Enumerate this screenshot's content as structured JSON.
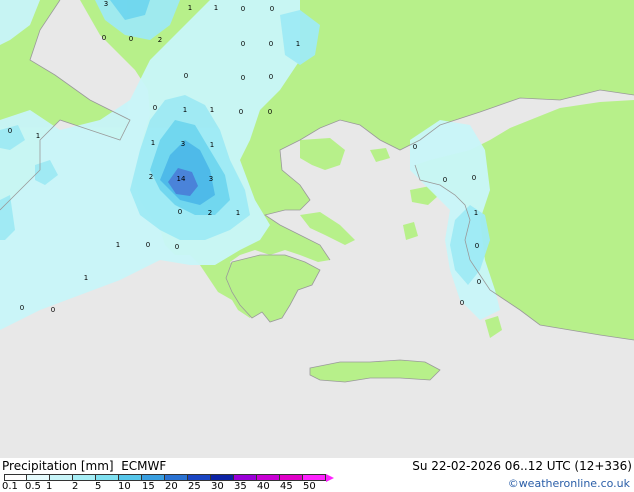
{
  "map": {
    "colors": {
      "sea": "#e8e8e8",
      "land": "#b7f08a",
      "coast": "#9a9a9a",
      "precip_light": "#c8f5f9",
      "precip_mid": "#9eeaf4",
      "precip_heavy": "#6fd6ee",
      "precip_strong": "#4cb8e8",
      "precip_peak": "#4a7fd8"
    },
    "labels": [
      {
        "text": "3"
      },
      {
        "text": "1"
      },
      {
        "text": "1"
      },
      {
        "text": "0"
      },
      {
        "text": "0"
      },
      {
        "text": "0"
      },
      {
        "text": "0"
      },
      {
        "text": "2"
      },
      {
        "text": "0"
      },
      {
        "text": "0"
      },
      {
        "text": "1"
      },
      {
        "text": "0"
      },
      {
        "text": "0"
      },
      {
        "text": "0"
      },
      {
        "text": "0"
      },
      {
        "text": "1"
      },
      {
        "text": "1"
      },
      {
        "text": "0"
      },
      {
        "text": "1"
      },
      {
        "text": "0"
      },
      {
        "text": "0"
      },
      {
        "text": "1"
      },
      {
        "text": "3"
      },
      {
        "text": "1"
      },
      {
        "text": "2"
      },
      {
        "text": "14"
      },
      {
        "text": "3"
      },
      {
        "text": "0"
      },
      {
        "text": "2"
      },
      {
        "text": "1"
      },
      {
        "text": "0"
      },
      {
        "text": "1"
      },
      {
        "text": "0"
      },
      {
        "text": "0"
      },
      {
        "text": "1"
      },
      {
        "text": "0"
      },
      {
        "text": "0"
      },
      {
        "text": "0"
      },
      {
        "text": "0"
      },
      {
        "text": "1"
      },
      {
        "text": "0"
      },
      {
        "text": "0"
      },
      {
        "text": "0"
      }
    ]
  },
  "footer": {
    "title": "Precipitation [mm]  ECMWF",
    "datetime": "Su 22-02-2026 06..12 UTC (12+336)",
    "credit": "©weatheronline.co.uk",
    "legend_ticks": [
      "0.1",
      "0.5",
      "1",
      "2",
      "5",
      "10",
      "15",
      "20",
      "25",
      "30",
      "35",
      "40",
      "45",
      "50"
    ],
    "legend_colors": [
      "#ffffff",
      "#e6fbfd",
      "#c8f5f9",
      "#a6eef6",
      "#7fe0f0",
      "#56c6ea",
      "#3a9fe0",
      "#2a72d2",
      "#1a45c2",
      "#0c22a4",
      "#9a00d8",
      "#c800d4",
      "#e000c8",
      "#ff22ff"
    ]
  }
}
